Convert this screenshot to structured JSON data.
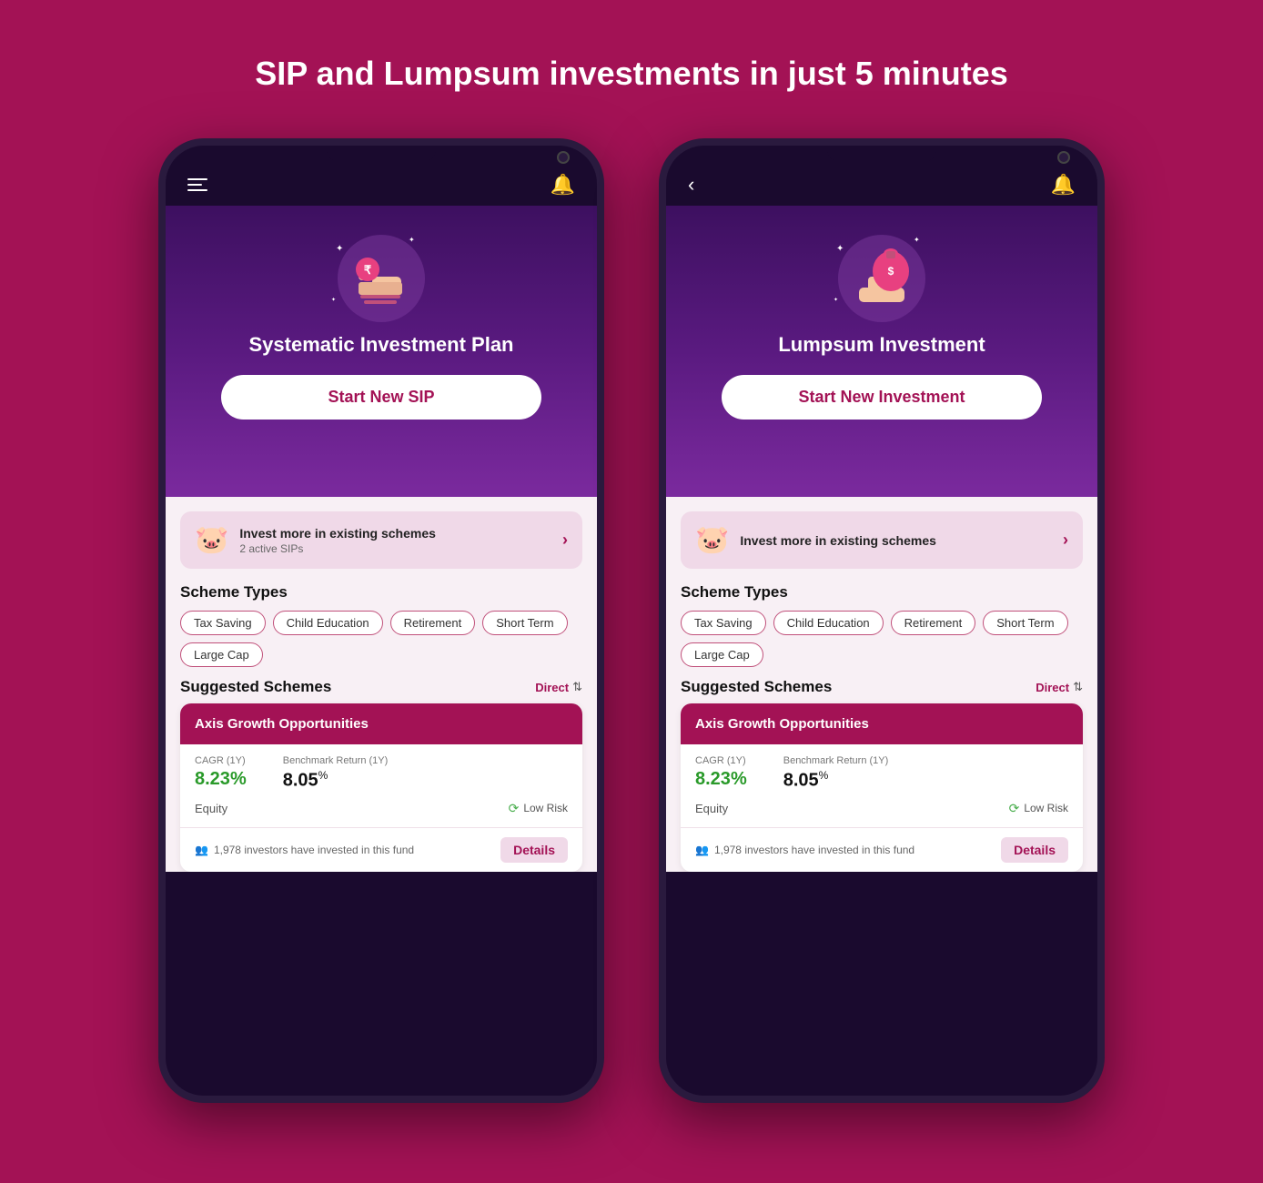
{
  "page": {
    "title": "SIP and Lumpsum investments in just 5 minutes",
    "background": "#a31255"
  },
  "phone1": {
    "hero": {
      "title": "Systematic Investment Plan",
      "cta_label": "Start New SIP"
    },
    "invest_banner": {
      "title": "Invest more in existing schemes",
      "subtitle": "2 active SIPs"
    },
    "scheme_types_title": "Scheme Types",
    "scheme_types": [
      "Tax Saving",
      "Child Education",
      "Retirement",
      "Short Term",
      "Large Cap"
    ],
    "suggested_title": "Suggested Schemes",
    "direct_label": "Direct",
    "scheme_name": "Axis Growth Opportunities",
    "cagr_label": "CAGR (1Y)",
    "cagr_value": "8.23",
    "cagr_unit": "%",
    "benchmark_label": "Benchmark Return (1Y)",
    "benchmark_value": "8.05",
    "benchmark_unit": "%",
    "equity_label": "Equity",
    "risk_label": "Low Risk",
    "investors_text": "1,978 investors have invested in this fund",
    "details_label": "Details"
  },
  "phone2": {
    "hero": {
      "title": "Lumpsum Investment",
      "cta_label": "Start New Investment"
    },
    "invest_banner": {
      "title": "Invest more in existing schemes",
      "subtitle": ""
    },
    "scheme_types_title": "Scheme Types",
    "scheme_types": [
      "Tax Saving",
      "Child Education",
      "Retirement",
      "Short Term",
      "Large Cap"
    ],
    "suggested_title": "Suggested Schemes",
    "direct_label": "Direct",
    "scheme_name": "Axis Growth Opportunities",
    "cagr_label": "CAGR (1Y)",
    "cagr_value": "8.23",
    "cagr_unit": "%",
    "benchmark_label": "Benchmark Return (1Y)",
    "benchmark_value": "8.05",
    "benchmark_unit": "%",
    "equity_label": "Equity",
    "risk_label": "Low Risk",
    "investors_text": "1,978 investors have invested in this fund",
    "details_label": "Details"
  }
}
